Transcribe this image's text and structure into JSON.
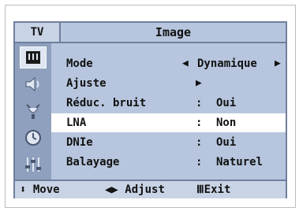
{
  "header": {
    "tab": "TV",
    "title": "Image"
  },
  "sidebar": {
    "icons": [
      {
        "name": "picture-icon",
        "active": true
      },
      {
        "name": "sound-icon",
        "active": false
      },
      {
        "name": "channel-antenna-icon",
        "active": false
      },
      {
        "name": "clock-icon",
        "active": false
      },
      {
        "name": "setup-sliders-icon",
        "active": false
      }
    ]
  },
  "menu": {
    "rows": [
      {
        "label": "Mode",
        "value": "Dynamique",
        "type": "selector"
      },
      {
        "label": "Ajuste",
        "type": "submenu"
      },
      {
        "label": "Réduc. bruit",
        "colon": ":",
        "value": "Oui"
      },
      {
        "label": "LNA",
        "colon": ":",
        "value": "Non",
        "selected": true
      },
      {
        "label": "DNIe",
        "colon": ":",
        "value": "Oui"
      },
      {
        "label": "Balayage",
        "colon": ":",
        "value": "Naturel"
      }
    ],
    "arrow_left": "◀",
    "arrow_right": "▶"
  },
  "footer": {
    "move_icon": "⬍",
    "move": "Move",
    "adjust_icon": "◀▶",
    "adjust": "Adjust",
    "exit_icon": "Ⅲ",
    "exit": "Exit"
  },
  "colors": {
    "frame": "#8ea0bd",
    "panel": "#b7c6de",
    "selected_row": "#ffffff",
    "text": "#111111"
  }
}
